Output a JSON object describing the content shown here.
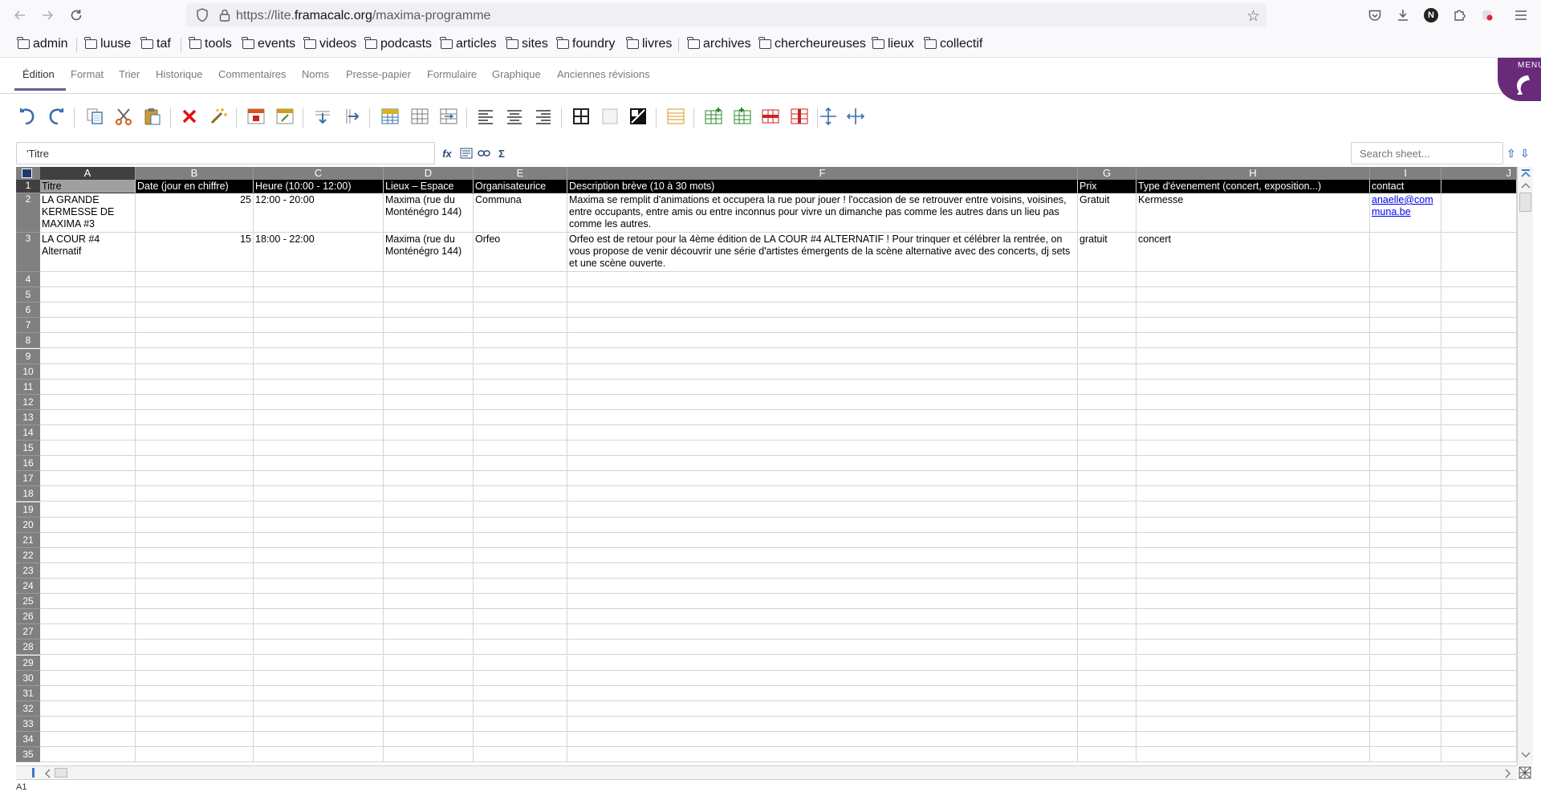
{
  "browser": {
    "url_prefix": "https://lite.",
    "url_host": "framacalc.org",
    "url_path": "/maxima-programme",
    "ext_badge": "N"
  },
  "bookmarks": [
    "admin",
    "luuse",
    "taf",
    "tools",
    "events",
    "videos",
    "podcasts",
    "articles",
    "sites",
    "foundry",
    "livres",
    "archives",
    "chercheureuses",
    "lieux",
    "collectif"
  ],
  "tabs": [
    "Édition",
    "Format",
    "Trier",
    "Historique",
    "Commentaires",
    "Noms",
    "Presse-papier",
    "Formulaire",
    "Graphique",
    "Anciennes révisions"
  ],
  "active_tab": "Édition",
  "menu_label": "MENU",
  "toolbar_icons": [
    "undo-icon",
    "redo-icon",
    "copy-icon",
    "cut-icon",
    "paste-icon",
    "delete-contents-icon",
    "paste-formats-icon",
    "lock-cell-icon",
    "unlock-cell-icon",
    "fill-down-icon",
    "fill-right-icon",
    "merge-cells-icon",
    "unmerge-cells-icon",
    "merge-alt-icon",
    "align-left-icon",
    "align-center-icon",
    "align-right-icon",
    "borders-icon",
    "clear-borders-icon",
    "color-icon",
    "multi-line-input-icon",
    "insert-row-icon",
    "insert-column-icon",
    "delete-row-icon",
    "delete-column-icon",
    "hide-row-icon",
    "hide-column-icon"
  ],
  "formula_bar": {
    "value": "'Titre",
    "search_placeholder": "Search sheet..."
  },
  "sheet": {
    "columns": [
      "A",
      "B",
      "C",
      "D",
      "E",
      "F",
      "G",
      "H",
      "I",
      "J"
    ],
    "header_row": [
      "Titre",
      "Date (jour en chiffre)",
      "Heure (10:00 - 12:00)",
      "Lieux – Espace",
      "Organisateurice",
      "Description brève (10 à 30 mots)",
      "Prix",
      "Type d'évenement (concert, exposition...)",
      "contact",
      ""
    ],
    "rows": [
      [
        "LA GRANDE KERMESSE DE MAXIMA #3",
        "25",
        "12:00 - 20:00",
        "Maxima (rue du Monténégro 144)",
        "Communa",
        "Maxima se remplit d'animations et occupera la rue pour jouer ! l'occasion de se retrouver entre voisins, voisines, entre occupants, entre amis ou entre inconnus pour vivre un dimanche pas comme les autres dans un lieu pas comme les autres.",
        "Gratuit",
        "Kermesse",
        "anaelle@communa.be",
        ""
      ],
      [
        "LA COUR #4 Alternatif",
        "15",
        "18:00 - 22:00",
        "Maxima (rue du Monténégro 144)",
        "Orfeo",
        "Orfeo est de retour pour la 4ème édition de LA COUR #4 ALTERNATIF ! Pour trinquer et célébrer la rentrée, on vous propose de venir découvrir une série d'artistes émergents de la scène alternative avec des concerts, dj sets et une scène ouverte.",
        "gratuit",
        "concert",
        "",
        ""
      ]
    ],
    "row_numbers": [
      "1",
      "2",
      "3",
      "4",
      "5",
      "6",
      "7",
      "8",
      "9",
      "10",
      "11",
      "12",
      "13",
      "14",
      "15",
      "16",
      "17",
      "18",
      "19",
      "20",
      "21",
      "22",
      "23",
      "24",
      "25",
      "26",
      "27",
      "28",
      "29",
      "30",
      "31",
      "32",
      "33",
      "34",
      "35"
    ],
    "selected_cell": "A1"
  }
}
